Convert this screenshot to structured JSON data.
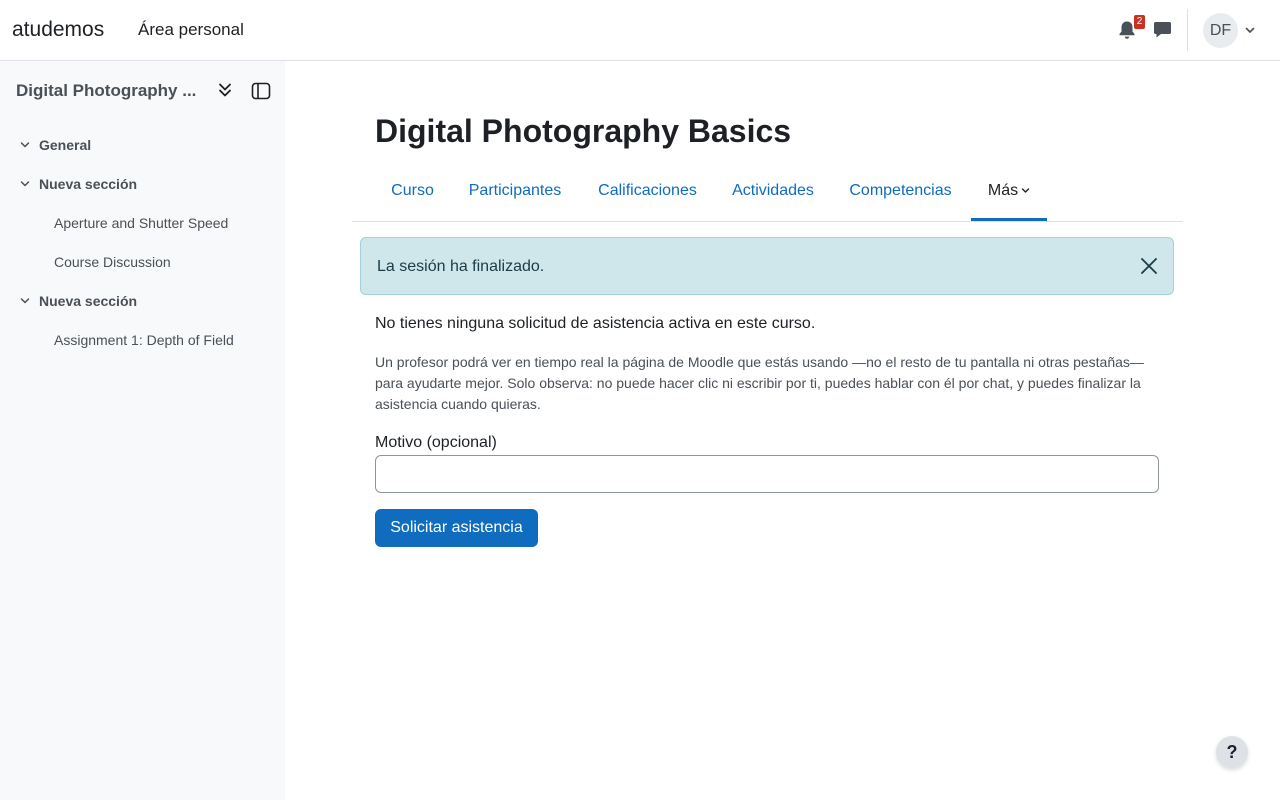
{
  "navbar": {
    "brand": "atudemos",
    "home_link": "Área personal",
    "notification_count": "2",
    "avatar_initials": "DF",
    "icons": [
      "bell-icon",
      "chat-icon",
      "chevron-down-icon"
    ]
  },
  "drawer": {
    "course_title": "Digital Photography ...",
    "sections": [
      {
        "label": "General",
        "activities": []
      },
      {
        "label": "Nueva sección",
        "activities": [
          "Aperture and Shutter Speed",
          "Course Discussion"
        ]
      },
      {
        "label": "Nueva sección",
        "activities": [
          "Assignment 1: Depth of Field"
        ]
      }
    ]
  },
  "page": {
    "title": "Digital Photography Basics",
    "tabs": [
      "Curso",
      "Participantes",
      "Calificaciones",
      "Actividades",
      "Competencias",
      "Más"
    ],
    "active_tab": "Más"
  },
  "alert": {
    "message": "La sesión ha finalizado."
  },
  "content": {
    "status": "No tienes ninguna solicitud de asistencia activa en este curso.",
    "help": "Un profesor podrá ver en tiempo real la página de Moodle que estás usando —no el resto de tu pantalla ni otras pestañas— para ayudarte mejor. Solo observa: no puede hacer clic ni escribir por ti, puedes hablar con él por chat, y puedes finalizar la asistencia cuando quieras.",
    "reason_label": "Motivo (opcional)",
    "reason_value": "",
    "submit_label": "Solicitar asistencia"
  },
  "footer": {
    "help_button": "?"
  },
  "colors": {
    "primary": "#0f6cbf",
    "alert_bg": "#cfe6ea",
    "drawer_bg": "#f8f9fa",
    "badge": "#ca3120"
  }
}
